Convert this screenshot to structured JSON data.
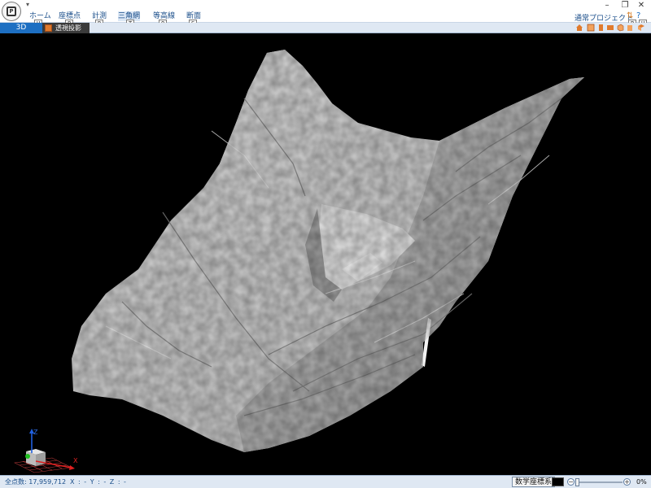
{
  "ribbon": {
    "tabs": [
      {
        "label": "ホーム",
        "keytip": "H"
      },
      {
        "label": "座標点",
        "keytip": "P"
      },
      {
        "label": "計測",
        "keytip": "R"
      },
      {
        "label": "三角網",
        "keytip": "T"
      },
      {
        "label": "等高線",
        "keytip": "O"
      },
      {
        "label": "断面",
        "keytip": "S"
      }
    ],
    "project_name": "通常プロジェクト",
    "help_keytip_b": "B",
    "help_keytip_h": "H",
    "help_symbol": "?"
  },
  "window_controls": {
    "minimize": "–",
    "restore": "❐",
    "close": "✕"
  },
  "document_tabs": {
    "active": "3D",
    "second": "透視投影"
  },
  "status_bar": {
    "point_count": "全点数: 17,959,712",
    "coords": "X : - Y : - Z : -",
    "coord_system": "数学座標系",
    "zoom_minus": "−",
    "zoom_plus": "+",
    "zoom_percent": "0%"
  },
  "gizmo": {
    "x_label": "X",
    "z_label": "Z"
  },
  "colors": {
    "accent_blue": "#1d6fc2",
    "ribbon_text": "#1a4e8a",
    "viewport_bg": "#000000",
    "terrain": "#c8c8c8",
    "axis_x": "#e02020",
    "axis_y": "#20c020",
    "axis_z": "#2060e0"
  },
  "icons": [
    "app-logo-icon",
    "quick-access-pin-icon",
    "home-icon",
    "view-cube-icon",
    "help-icon",
    "perspective-icon"
  ]
}
